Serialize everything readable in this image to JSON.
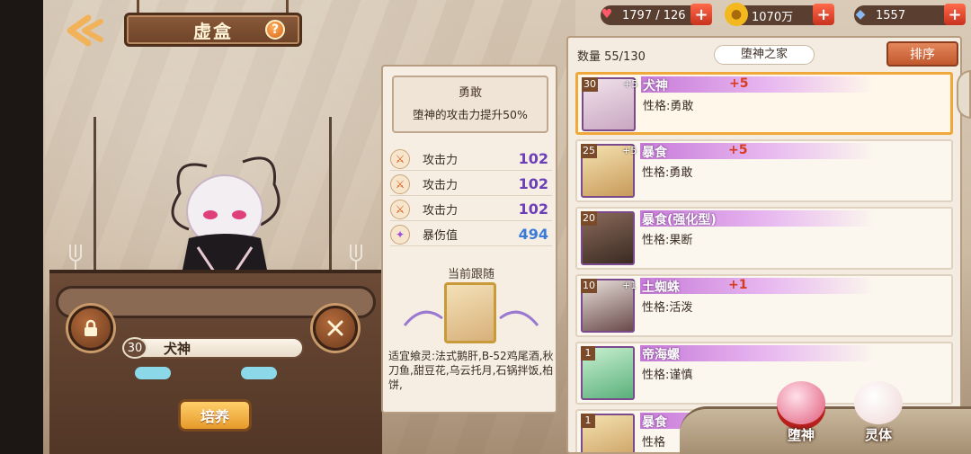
{
  "header": {
    "title": "虚盒",
    "help": "?"
  },
  "currency": [
    {
      "icon": "heart-icon",
      "value": "1797 / 126",
      "color": "#ff5a6a"
    },
    {
      "icon": "gold-coin-icon",
      "value": "1070万",
      "color": "#f2b81e"
    },
    {
      "icon": "crystal-icon",
      "value": "1557",
      "color": "#8ab8f0"
    }
  ],
  "selected": {
    "level": "30",
    "name": "犬神",
    "cultivate_label": "培养"
  },
  "detail": {
    "trait_name": "勇敢",
    "trait_desc": "堕神的攻击力提升50%",
    "stats": [
      {
        "label": "攻击力",
        "value": "102",
        "icon": "sword-icon"
      },
      {
        "label": "攻击力",
        "value": "102",
        "icon": "sword-icon"
      },
      {
        "label": "攻击力",
        "value": "102",
        "icon": "sword-icon"
      },
      {
        "label": "暴伤值",
        "value": "494",
        "icon": "crit-icon"
      }
    ],
    "follow_label": "当前跟随",
    "fit_text": "适宜飨灵:法式鹅肝,B-52鸡尾酒,秋刀鱼,甜豆花,乌云托月,石锅拌饭,柏饼,"
  },
  "list": {
    "count": "数量 55/130",
    "filter": "堕神之家",
    "sort_label": "排序",
    "rows": [
      {
        "level": "30",
        "plus_tag": "+5",
        "name": "犬神",
        "bonus": "+5",
        "trait": "性格:勇敢",
        "selected": true
      },
      {
        "level": "25",
        "plus_tag": "+5",
        "name": "暴食",
        "bonus": "+5",
        "trait": "性格:勇敢",
        "selected": false
      },
      {
        "level": "20",
        "plus_tag": "",
        "name": "暴食(强化型)",
        "bonus": "",
        "trait": "性格:果断",
        "selected": false
      },
      {
        "level": "10",
        "plus_tag": "+1",
        "name": "土蜘蛛",
        "bonus": "+1",
        "trait": "性格:活泼",
        "selected": false
      },
      {
        "level": "1",
        "plus_tag": "",
        "name": "帝海螺",
        "bonus": "",
        "trait": "性格:谨慎",
        "selected": false
      },
      {
        "level": "1",
        "plus_tag": "",
        "name": "暴食",
        "bonus": "",
        "trait": "性格",
        "selected": false
      }
    ]
  },
  "modes": [
    {
      "label": "堕神",
      "icon": "fallen-god-icon"
    },
    {
      "label": "灵体",
      "icon": "spirit-icon"
    }
  ]
}
